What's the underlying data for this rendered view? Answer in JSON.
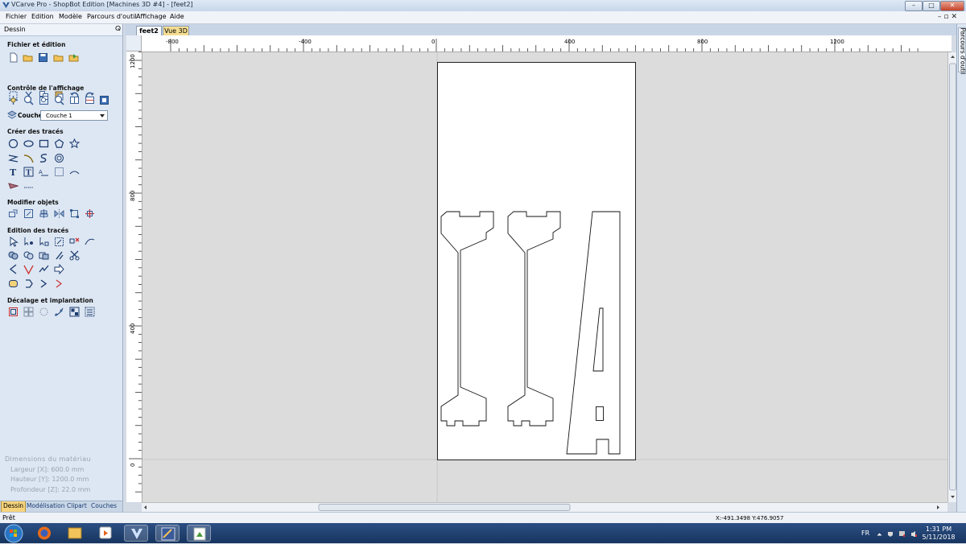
{
  "window": {
    "title": "VCarve Pro - ShopBot Edition [Machines 3D #4] - [feet2]"
  },
  "menu": [
    "Fichier",
    "Edition",
    "Modèle",
    "Parcours d'outil",
    "Affichage",
    "Aide"
  ],
  "left_panel": {
    "title": "Dessin",
    "pin": "⊕",
    "sections": {
      "file": "Fichier et édition",
      "view": "Contrôle de l'affichage",
      "create": "Créer des tracés",
      "modify": "Modifier objets",
      "edit": "Edition des tracés",
      "offset": "Décalage et implantation"
    },
    "layer_label": "Couche",
    "layer_value": "Couche 1",
    "dimensions": {
      "title": "Dimensions du matériau",
      "width": "Largeur   [X]: 600.0 mm",
      "height": "Hauteur   [Y]: 1200.0 mm",
      "depth": "Profondeur [Z]: 22.0 mm"
    },
    "tabs": [
      "Dessin",
      "Modélisation",
      "Clipart",
      "Couches"
    ]
  },
  "doc_tabs": [
    "feet2",
    "Vue 3D"
  ],
  "ruler_top": [
    "-800",
    "-400",
    "0",
    "400",
    "800",
    "1200"
  ],
  "ruler_left": [
    "1200",
    "800",
    "400",
    "0"
  ],
  "right_panel": {
    "label": "Parcours d'outil"
  },
  "status": {
    "text": "Prêt",
    "coords": "X:-491.3498 Y:476.9057"
  },
  "tray": {
    "lang": "FR",
    "time": "1:31 PM",
    "date": "5/11/2018"
  },
  "colors": {
    "panel": "#dde7f3",
    "canvas": "#dcdcdc",
    "sheet": "#ffffff",
    "accent_tab": "#f6d37a",
    "taskbar": "#1e3f6f"
  }
}
